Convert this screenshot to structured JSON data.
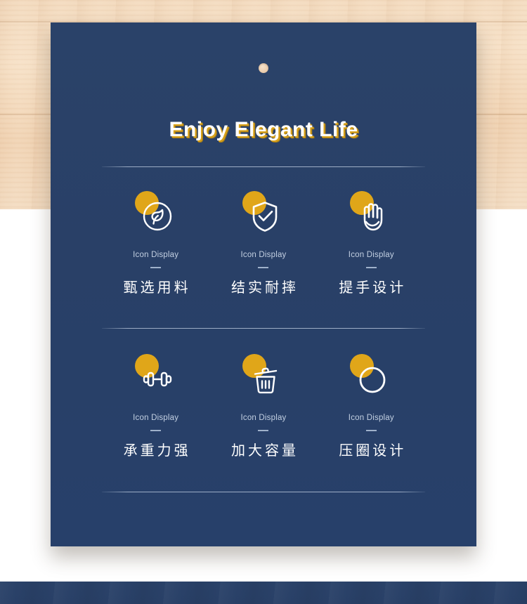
{
  "card": {
    "title": "Enjoy Elegant Life",
    "punch_hole": "lanyard-hole",
    "accent_gold": "#e0a619",
    "card_navy": "#294067",
    "caption_color": "#c3d0e2"
  },
  "features": [
    {
      "icon": "leaf-in-circle-icon",
      "caption": "Icon Display",
      "label": "甄选用料"
    },
    {
      "icon": "shield-check-icon",
      "caption": "Icon Display",
      "label": "结实耐摔"
    },
    {
      "icon": "hand-palm-icon",
      "caption": "Icon Display",
      "label": "提手设计"
    },
    {
      "icon": "dumbbell-icon",
      "caption": "Icon Display",
      "label": "承重力强"
    },
    {
      "icon": "trash-bin-icon",
      "caption": "Icon Display",
      "label": "加大容量"
    },
    {
      "icon": "ring-circle-icon",
      "caption": "Icon Display",
      "label": "压圈设计"
    }
  ]
}
